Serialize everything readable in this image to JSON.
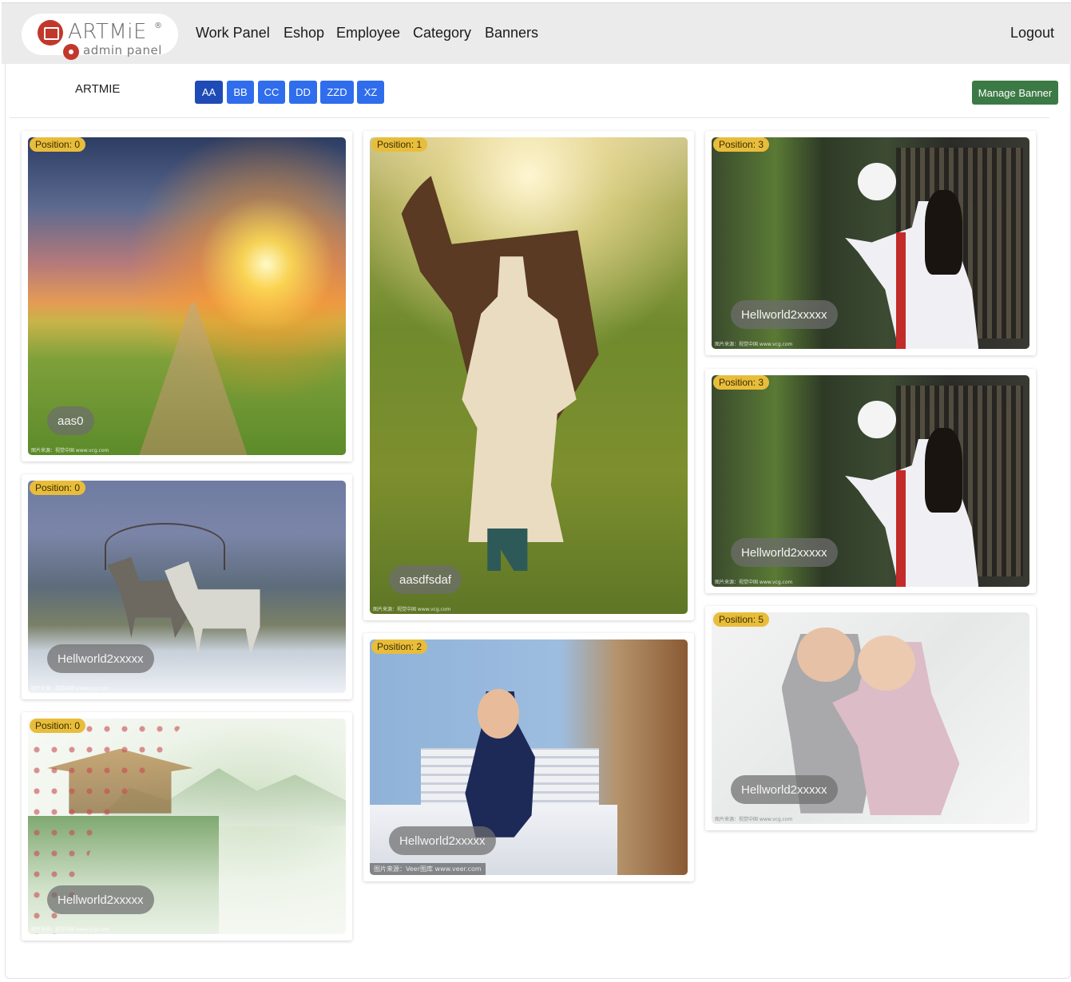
{
  "navbar": {
    "logo": {
      "title": "ARTMiE",
      "registered": "®",
      "subtitle": "admin panel"
    },
    "links": [
      "Work Panel",
      "Eshop",
      "Employee",
      "Category",
      "Banners"
    ],
    "logout": "Logout"
  },
  "toolbar": {
    "brand": "ARTMIE",
    "tabs": [
      "AA",
      "BB",
      "CC",
      "DD",
      "ZZD",
      "XZ"
    ],
    "active_tab": "AA",
    "manage_banner": "Manage Banner"
  },
  "banners": [
    {
      "position": "Position: 0",
      "title": "aas0",
      "credit": "图片来源：视觉中国 www.vcg.com",
      "image": "sunset-road"
    },
    {
      "position": "Position: 0",
      "title": "Hellworld2xxxxx",
      "credit": "图片来源：视觉中国 www.vcg.com",
      "image": "reindeer-snow"
    },
    {
      "position": "Position: 0",
      "title": "Hellworld2xxxxx",
      "credit": "图片来源：视觉中国 www.vcg.com",
      "image": "ink-painting"
    },
    {
      "position": "Position: 1",
      "title": "aasdfsdaf",
      "credit": "图片来源：视觉中国 www.vcg.com",
      "image": "woman-horse"
    },
    {
      "position": "Position: 2",
      "title": "Hellworld2xxxxx",
      "credit": "图片来源：Veer图库 www.veer.com",
      "image": "crying-baby"
    },
    {
      "position": "Position: 3",
      "title": "Hellworld2xxxxx",
      "credit": "图片来源：视觉中国 www.vcg.com",
      "image": "hanfu-woman"
    },
    {
      "position": "Position: 3",
      "title": "Hellworld2xxxxx",
      "credit": "图片来源：视觉中国 www.vcg.com",
      "image": "hanfu-woman"
    },
    {
      "position": "Position: 5",
      "title": "Hellworld2xxxxx",
      "credit": "图片来源：视觉中国 www.vcg.com",
      "image": "kids-hugging"
    }
  ],
  "colors": {
    "navbar_bg": "#ebebeb",
    "tab_blue": "#2f6ded",
    "tab_active": "#1e4bb5",
    "manage_green": "#3c7a45",
    "badge_yellow": "#e8bd3b",
    "logo_red": "#c2372c"
  }
}
